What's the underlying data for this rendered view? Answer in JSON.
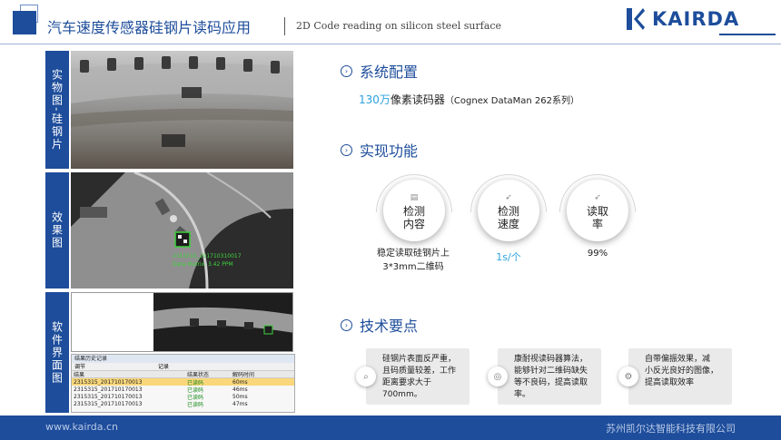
{
  "header": {
    "title": "汽车速度传感器硅钢片读码应用",
    "subtitle": "2D Code reading on silicon steel surface",
    "logo_text": "KAIRDA"
  },
  "left_panels": [
    {
      "label": "实物图-硅钢片"
    },
    {
      "label": "效果图"
    },
    {
      "label": "软件界面图"
    }
  ],
  "effect_overlay": {
    "line1": "2315315_201710310017",
    "line2": "Data Matrix, 3.42 PPM"
  },
  "software": {
    "window_title": "结果历史记录",
    "toolbar": [
      "调节",
      "记录"
    ],
    "columns": [
      "结果",
      "",
      "结果状态",
      "解码时间"
    ],
    "rows": [
      {
        "id": "2315315_201710170013",
        "status": "已读码",
        "time": "60ms"
      },
      {
        "id": "2315315_201710170013",
        "status": "已读码",
        "time": "46ms"
      },
      {
        "id": "2315315_201710170013",
        "status": "已读码",
        "time": "50ms"
      },
      {
        "id": "2315315_201710170013",
        "status": "已读码",
        "time": "47ms"
      },
      {
        "id": "2315315_201710170013",
        "status": "已读码",
        "time": "46ms"
      }
    ]
  },
  "sections": {
    "config": {
      "title": "系统配置",
      "highlight": "130万",
      "text": "像素读码器",
      "note": "（Cognex DataMan 262系列）"
    },
    "features": {
      "title": "实现功能",
      "items": [
        {
          "label_line1": "检测",
          "label_line2": "内容",
          "caption1": "稳定读取硅钢片上",
          "caption2": "3*3mm二维码",
          "icon": "document-icon"
        },
        {
          "label_line1": "检测",
          "label_line2": "速度",
          "caption1": "1s/个",
          "caption2": "",
          "icon": "rocket-icon"
        },
        {
          "label_line1": "读取",
          "label_line2": "率",
          "caption1": "99%",
          "caption2": "",
          "icon": "rocket-icon"
        }
      ]
    },
    "tech": {
      "title": "技术要点",
      "cards": [
        {
          "lines": [
            "硅钢片表面反严重，",
            "且码质量较差，工作",
            "距离要求大于700mm。"
          ],
          "icon": "search-icon"
        },
        {
          "lines": [
            "康耐视读码器算法，",
            "能够针对二维码缺失",
            "等不良码，提高读取率。"
          ],
          "icon": "target-icon"
        },
        {
          "lines": [
            "自带偏振效果，减",
            "小反光良好的图像，",
            "提高读取效率"
          ],
          "icon": "gear-icon"
        }
      ]
    }
  },
  "footer": {
    "website": "www.kairda.cn",
    "company": "苏州凯尔达智能科技有限公司"
  },
  "colors": {
    "brand": "#1d4d9b",
    "accent": "#2ba1e0"
  }
}
